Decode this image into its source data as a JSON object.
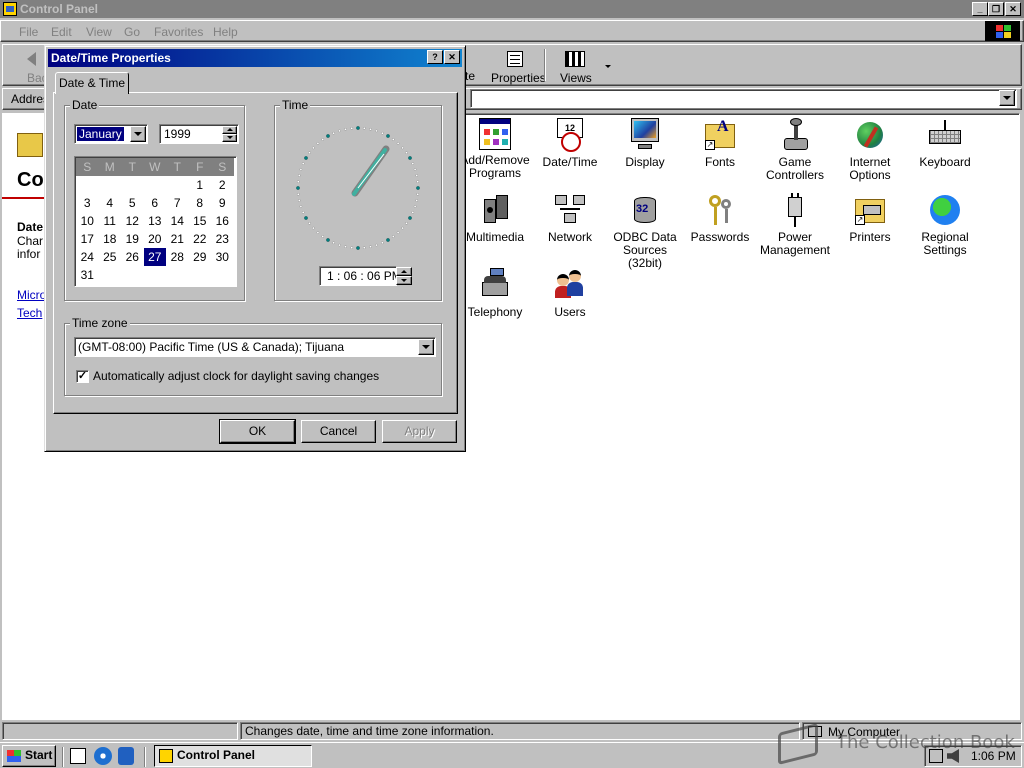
{
  "window": {
    "title": "Control Panel"
  },
  "menu": [
    "File",
    "Edit",
    "View",
    "Go",
    "Favorites",
    "Help"
  ],
  "toolbar": {
    "back": "Back",
    "delete_partial": "te",
    "properties": "Properties",
    "views": "Views"
  },
  "address": {
    "label": "Address"
  },
  "left_pane": {
    "title_partial": "Co",
    "heading_partial": "Date",
    "desc_line1": "Char",
    "desc_line2": "infor",
    "link1": "Micro",
    "link2": "Tech"
  },
  "icons": [
    {
      "name": "Add/Remove Programs",
      "line1": "Add/Remove",
      "line2": "Programs"
    },
    {
      "name": "Date/Time",
      "line1": "Date/Time",
      "line2": ""
    },
    {
      "name": "Display",
      "line1": "Display",
      "line2": ""
    },
    {
      "name": "Fonts",
      "line1": "Fonts",
      "line2": ""
    },
    {
      "name": "Game Controllers",
      "line1": "Game",
      "line2": "Controllers"
    },
    {
      "name": "Internet Options",
      "line1": "Internet",
      "line2": "Options"
    },
    {
      "name": "Keyboard",
      "line1": "Keyboard",
      "line2": ""
    },
    {
      "name": "Multimedia",
      "line1": "Multimedia",
      "line2": ""
    },
    {
      "name": "Network",
      "line1": "Network",
      "line2": ""
    },
    {
      "name": "ODBC Data Sources (32bit)",
      "line1": "ODBC Data",
      "line2": "Sources (32bit)"
    },
    {
      "name": "Passwords",
      "line1": "Passwords",
      "line2": ""
    },
    {
      "name": "Power Management",
      "line1": "Power",
      "line2": "Management"
    },
    {
      "name": "Printers",
      "line1": "Printers",
      "line2": ""
    },
    {
      "name": "Regional Settings",
      "line1": "Regional",
      "line2": "Settings"
    },
    {
      "name": "Telephony",
      "line1": "Telephony",
      "line2": ""
    },
    {
      "name": "Users",
      "line1": "Users",
      "line2": ""
    }
  ],
  "status": {
    "message": "Changes date, time and time zone information.",
    "zone": "My Computer"
  },
  "taskbar": {
    "start": "Start",
    "task": "Control Panel",
    "clock": "1:06 PM"
  },
  "watermark": "The Collection Book",
  "dialog": {
    "title": "Date/Time Properties",
    "tab": "Date & Time",
    "date_group": "Date",
    "time_group": "Time",
    "month": "January",
    "year": "1999",
    "weekdays": [
      "S",
      "M",
      "T",
      "W",
      "T",
      "F",
      "S"
    ],
    "weeks": [
      [
        "",
        "",
        "",
        "",
        "",
        "1",
        "2"
      ],
      [
        "3",
        "4",
        "5",
        "6",
        "7",
        "8",
        "9"
      ],
      [
        "10",
        "11",
        "12",
        "13",
        "14",
        "15",
        "16"
      ],
      [
        "17",
        "18",
        "19",
        "20",
        "21",
        "22",
        "23"
      ],
      [
        "24",
        "25",
        "26",
        "27",
        "28",
        "29",
        "30"
      ],
      [
        "31",
        "",
        "",
        "",
        "",
        "",
        ""
      ]
    ],
    "selected_day": "27",
    "time_value": "1 : 06 : 06 PM",
    "timezone_group": "Time zone",
    "timezone": "(GMT-08:00) Pacific Time (US & Canada); Tijuana",
    "dst_label": "Automatically adjust clock for daylight saving changes",
    "dst_checked": true,
    "ok": "OK",
    "cancel": "Cancel",
    "apply": "Apply"
  }
}
